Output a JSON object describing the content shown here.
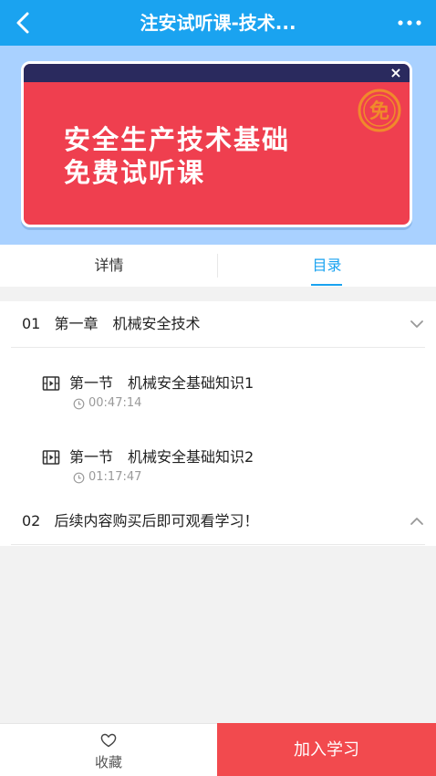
{
  "header": {
    "title": "注安试听课-技术..."
  },
  "banner": {
    "line1": "安全生产技术基础",
    "line2": "免费试听课",
    "seal_text": "免",
    "close_label": "×",
    "colors": {
      "background": "#ef3f4f",
      "top_bar": "#2a2a5e",
      "seal": "#f08a2b"
    }
  },
  "tabs": [
    {
      "label": "详情",
      "active": false
    },
    {
      "label": "目录",
      "active": true
    }
  ],
  "catalog": {
    "chapters": [
      {
        "number": "01",
        "title": "第一章　机械安全技术",
        "expanded": true,
        "lessons": [
          {
            "title": "第一节　机械安全基础知识1",
            "duration": "00:47:14"
          },
          {
            "title": "第一节　机械安全基础知识2",
            "duration": "01:17:47"
          }
        ]
      },
      {
        "number": "02",
        "title": "后续内容购买后即可观看学习！",
        "expanded": false
      }
    ]
  },
  "bottom_bar": {
    "favorite_label": "收藏",
    "join_label": "加入学习"
  },
  "colors": {
    "accent": "#1aa3f0",
    "cta": "#f24a4e",
    "banner_bg": "#a9d1ff"
  }
}
